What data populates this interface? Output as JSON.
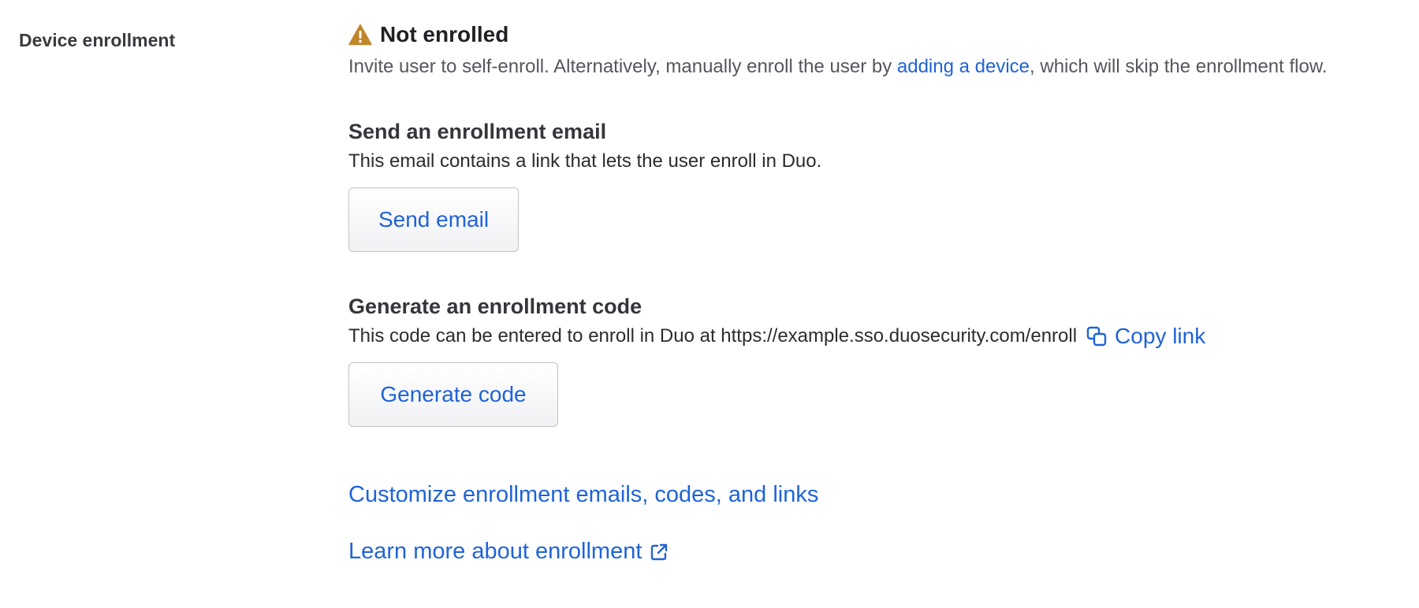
{
  "row_label": "Device enrollment",
  "status": {
    "icon": "warning-icon",
    "text": "Not enrolled",
    "color": "#c1862a"
  },
  "intro": {
    "before": "Invite user to self-enroll. Alternatively, manually enroll the user by ",
    "link": "adding a device",
    "after": ", which will skip the enrollment flow."
  },
  "email_section": {
    "title": "Send an enrollment email",
    "description": "This email contains a link that lets the user enroll in Duo.",
    "button": "Send email"
  },
  "code_section": {
    "title": "Generate an enrollment code",
    "description": "This code can be entered to enroll in Duo at https://example.sso.duosecurity.com/enroll",
    "copy_link": "Copy link",
    "copy_icon": "copy-icon",
    "button": "Generate code"
  },
  "links": {
    "customize": "Customize enrollment emails, codes, and links",
    "learn_more": "Learn more about enrollment",
    "external_icon": "external-link-icon"
  },
  "colors": {
    "link": "#1f63d8",
    "warning": "#c1862a"
  }
}
